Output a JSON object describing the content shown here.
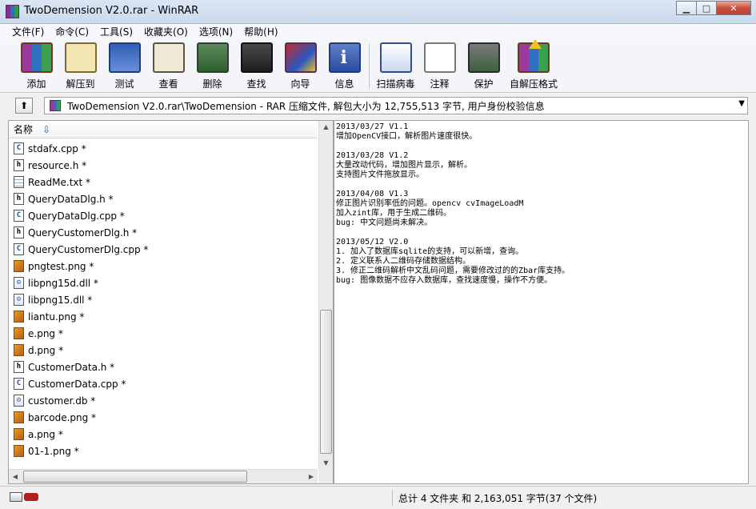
{
  "window": {
    "title": "TwoDemension V2.0.rar - WinRAR",
    "minimize_glyph": "▁",
    "maximize_glyph": "□",
    "close_glyph": "✕"
  },
  "menu": [
    "文件(F)",
    "命令(C)",
    "工具(S)",
    "收藏夹(O)",
    "选项(N)",
    "帮助(H)"
  ],
  "toolbar": [
    {
      "label": "添加",
      "icon": "add-archive-icon"
    },
    {
      "label": "解压到",
      "icon": "extract-to-icon"
    },
    {
      "label": "测试",
      "icon": "test-icon"
    },
    {
      "label": "查看",
      "icon": "view-icon"
    },
    {
      "label": "删除",
      "icon": "delete-icon"
    },
    {
      "label": "查找",
      "icon": "find-icon"
    },
    {
      "label": "向导",
      "icon": "wizard-icon"
    },
    {
      "label": "信息",
      "icon": "info-icon"
    },
    {
      "label": "扫描病毒",
      "icon": "scan-virus-icon"
    },
    {
      "label": "注释",
      "icon": "comment-icon"
    },
    {
      "label": "保护",
      "icon": "protect-icon"
    },
    {
      "label": "自解压格式",
      "icon": "sfx-icon"
    }
  ],
  "path": {
    "up_glyph": "⬆",
    "text": "TwoDemension V2.0.rar\\TwoDemension - RAR 压缩文件, 解包大小为 12,755,513 字节, 用户身份校验信息",
    "dropdown_glyph": "▼"
  },
  "filelist": {
    "header": "名称",
    "sort_glyph": "⇩",
    "files": [
      {
        "name": "stdafx.cpp *",
        "type": "cpp"
      },
      {
        "name": "resource.h *",
        "type": "h"
      },
      {
        "name": "ReadMe.txt *",
        "type": "txt"
      },
      {
        "name": "QueryDataDlg.h *",
        "type": "h"
      },
      {
        "name": "QueryDataDlg.cpp *",
        "type": "cpp"
      },
      {
        "name": "QueryCustomerDlg.h *",
        "type": "h"
      },
      {
        "name": "QueryCustomerDlg.cpp *",
        "type": "cpp"
      },
      {
        "name": "pngtest.png *",
        "type": "png"
      },
      {
        "name": "libpng15d.dll *",
        "type": "dll"
      },
      {
        "name": "libpng15.dll *",
        "type": "dll"
      },
      {
        "name": "liantu.png *",
        "type": "png"
      },
      {
        "name": "e.png *",
        "type": "png"
      },
      {
        "name": "d.png *",
        "type": "png"
      },
      {
        "name": "CustomerData.h *",
        "type": "h"
      },
      {
        "name": "CustomerData.cpp *",
        "type": "cpp"
      },
      {
        "name": "customer.db *",
        "type": "db"
      },
      {
        "name": "barcode.png *",
        "type": "png"
      },
      {
        "name": "a.png *",
        "type": "png"
      },
      {
        "name": "01-1.png *",
        "type": "png"
      }
    ]
  },
  "scroll": {
    "up": "▲",
    "down": "▼",
    "left": "◀",
    "right": "▶"
  },
  "comment_lines": [
    "2013/03/27 V1.1",
    "增加OpenCV接口，解析图片速度很快。",
    "",
    "2013/03/28 V1.2",
    "大量改动代码，增加图片显示，解析。",
    "支持图片文件拖放显示。",
    "",
    "2013/04/08 V1.3",
    "修正图片识别率低的问题。opencv cvImageLoadM",
    "加入zint库，用于生成二维码。",
    "bug: 中文问题尚未解决。",
    "",
    "2013/05/12 V2.0",
    "1. 加入了数据库sqlite的支持，可以新增，查询。",
    "2. 定义联系人二维码存储数据结构。",
    "3. 修正二维码解析中文乱码问题，需要修改过的的Zbar库支持。",
    "bug: 图像数据不应存入数据库，查找速度慢，操作不方便。"
  ],
  "status": {
    "text": "总计 4 文件夹 和 2,163,051 字节(37 个文件)"
  }
}
